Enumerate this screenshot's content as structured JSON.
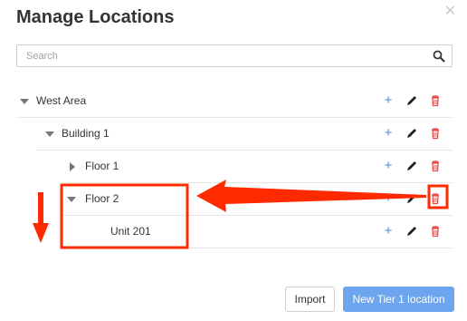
{
  "modal": {
    "title": "Manage Locations",
    "close_icon": "close-icon"
  },
  "search": {
    "placeholder": "Search",
    "value": "",
    "icon": "search-icon"
  },
  "tree": {
    "rows": [
      {
        "label": "West Area",
        "expanded": true,
        "depth": 0
      },
      {
        "label": "Building 1",
        "expanded": true,
        "depth": 1
      },
      {
        "label": "Floor 1",
        "expanded": false,
        "depth": 2
      },
      {
        "label": "Floor 2",
        "expanded": true,
        "depth": 2
      },
      {
        "label": "Unit 201",
        "expanded": null,
        "depth": 3
      }
    ],
    "action_icons": [
      "plus-icon",
      "pencil-icon",
      "trash-icon"
    ]
  },
  "footer": {
    "import_label": "Import",
    "new_label": "New Tier 1 location"
  },
  "colors": {
    "accent_blue": "#4a90e2",
    "primary_button": "#6ea5ef",
    "delete_red": "#e94b4b",
    "annotation_red": "#ff2a00"
  }
}
